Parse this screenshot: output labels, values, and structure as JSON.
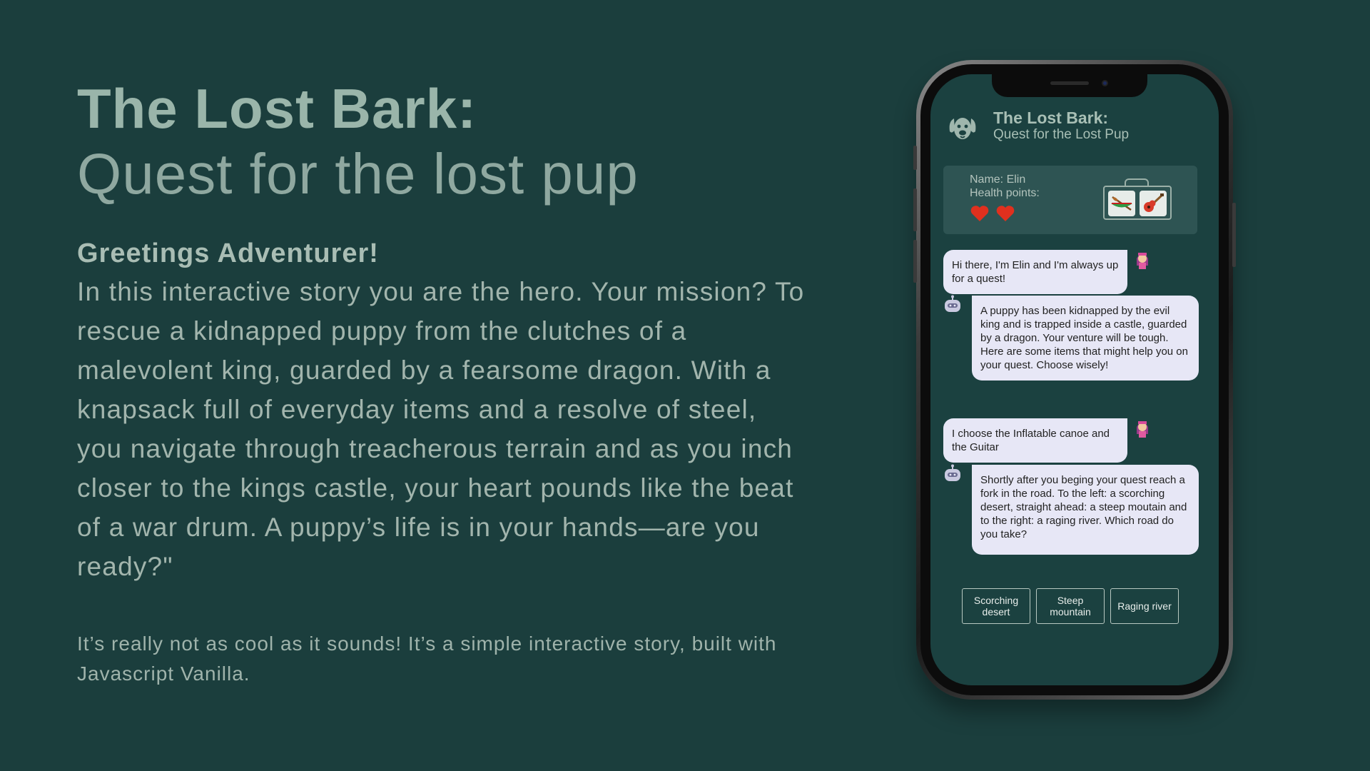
{
  "hero": {
    "title": "The Lost Bark:",
    "subtitle": "Quest for the lost pup",
    "greeting": "Greetings Adventurer!",
    "intro": "In this interactive story you are the hero. Your mission? To rescue a kidnapped puppy from the clutches of a malevolent king, guarded by a fearsome dragon. With a knapsack full of everyday items and a resolve of steel, you navigate through treacherous terrain and as you inch closer to the kings castle, your heart pounds like the beat of a war drum. A puppy’s life is in your hands—are you ready?\"",
    "note": "It’s really not as cool as it sounds! It’s a simple interactive story, built with Javascript Vanilla."
  },
  "app": {
    "logo_icon": "dog-face-icon",
    "title": "The Lost Bark:",
    "subtitle": "Quest for the Lost Pup",
    "status": {
      "name_label": "Name: Elin",
      "health_label": "Health points:",
      "hearts": 2,
      "knapsack_items": [
        "canoe-icon",
        "guitar-icon"
      ]
    },
    "messages": [
      {
        "from": "user",
        "text": "Hi there, I'm Elin and I'm always up for a quest!"
      },
      {
        "from": "bot",
        "text": "A puppy has been kidnapped by the evil king and is trapped inside a castle, guarded by a dragon. Your venture will be tough. Here are some items that might help you on your quest. Choose wisely!"
      },
      {
        "from": "user",
        "text": "I choose the Inflatable canoe and the Guitar"
      },
      {
        "from": "bot",
        "text": "Shortly after you beging your quest reach a fork in the road. To the left: a scorching desert, straight ahead: a steep moutain and to the right: a raging river. Which road do you take?"
      }
    ],
    "choices": [
      "Scorching desert",
      "Steep mountain",
      "Raging river"
    ]
  },
  "colors": {
    "background": "#1b3e3d",
    "screen": "#1b4140",
    "bubble": "#e7e7f6",
    "heart": "#e0301e"
  }
}
